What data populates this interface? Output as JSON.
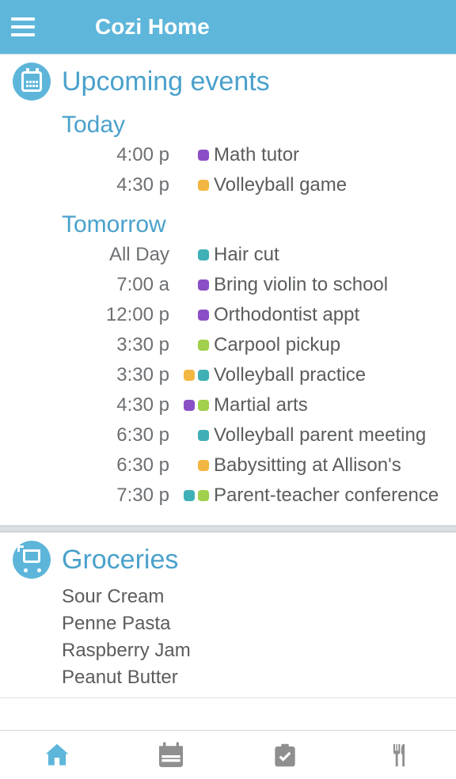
{
  "header": {
    "title": "Cozi Home"
  },
  "events": {
    "title": "Upcoming events",
    "groups": [
      {
        "label": "Today",
        "items": [
          {
            "time": "4:00 p",
            "dots": [
              "purple"
            ],
            "name": "Math tutor"
          },
          {
            "time": "4:30 p",
            "dots": [
              "orange"
            ],
            "name": "Volleyball game"
          }
        ]
      },
      {
        "label": "Tomorrow",
        "items": [
          {
            "time": "All Day",
            "dots": [
              "teal"
            ],
            "name": "Hair cut"
          },
          {
            "time": "7:00 a",
            "dots": [
              "purple"
            ],
            "name": "Bring violin to school"
          },
          {
            "time": "12:00 p",
            "dots": [
              "purple"
            ],
            "name": "Orthodontist appt"
          },
          {
            "time": "3:30 p",
            "dots": [
              "green"
            ],
            "name": "Carpool pickup"
          },
          {
            "time": "3:30 p",
            "dots": [
              "orange",
              "teal"
            ],
            "name": "Volleyball practice"
          },
          {
            "time": "4:30 p",
            "dots": [
              "purple",
              "green"
            ],
            "name": "Martial arts"
          },
          {
            "time": "6:30 p",
            "dots": [
              "teal"
            ],
            "name": "Volleyball parent meeting"
          },
          {
            "time": "6:30 p",
            "dots": [
              "orange"
            ],
            "name": "Babysitting at Allison's"
          },
          {
            "time": "7:30 p",
            "dots": [
              "teal",
              "green"
            ],
            "name": "Parent-teacher conference"
          }
        ]
      }
    ]
  },
  "groceries": {
    "title": "Groceries",
    "items": [
      "Sour Cream",
      "Penne Pasta",
      "Raspberry Jam",
      "Peanut Butter"
    ]
  },
  "tabs": {
    "home": "home-icon",
    "calendar": "calendar-icon",
    "lists": "lists-icon",
    "meals": "meals-icon"
  },
  "colors": {
    "brand": "#5eb6da",
    "accentText": "#4aa1cb",
    "bodyText": "#5a5c5e",
    "dots": {
      "purple": "#8a4fc5",
      "orange": "#f2b742",
      "teal": "#3fb0b5",
      "green": "#a0d04c"
    }
  }
}
